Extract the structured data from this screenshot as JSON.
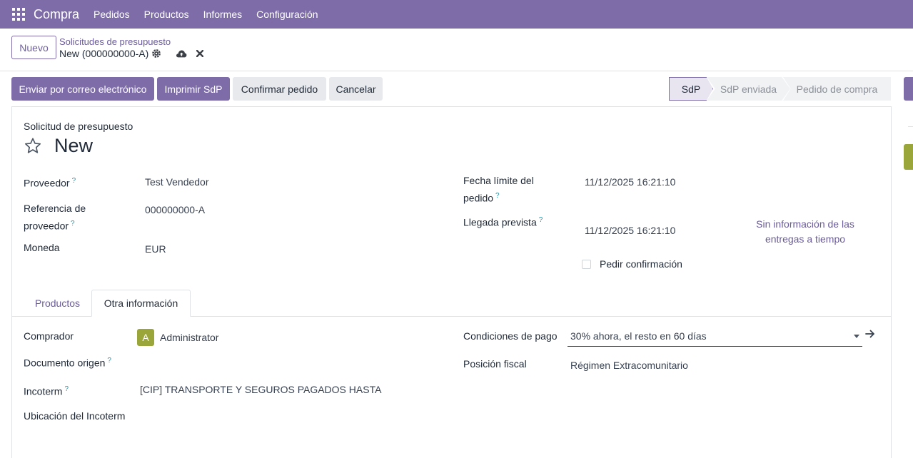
{
  "nav": {
    "app_name": "Compra",
    "menu": [
      "Pedidos",
      "Productos",
      "Informes",
      "Configuración"
    ]
  },
  "control_panel": {
    "new_button": "Nuevo",
    "breadcrumb_parent": "Solicitudes de presupuesto",
    "breadcrumb_current": "New (000000000-A)"
  },
  "actions": {
    "send_email": "Enviar por correo electrónico",
    "print_rfq": "Imprimir SdP",
    "confirm_order": "Confirmar pedido",
    "cancel": "Cancelar"
  },
  "statusbar": [
    "SdP",
    "SdP enviada",
    "Pedido de compra"
  ],
  "form": {
    "subtitle": "Solicitud de presupuesto",
    "title": "New",
    "left": {
      "vendor_label": "Proveedor",
      "vendor_value": "Test Vendedor",
      "vendor_ref_label_1": "Referencia de",
      "vendor_ref_label_2": "proveedor",
      "vendor_ref_value": "000000000-A",
      "currency_label": "Moneda",
      "currency_value": "EUR"
    },
    "right": {
      "deadline_label_1": "Fecha límite del",
      "deadline_label_2": "pedido",
      "deadline_value": "11/12/2025 16:21:10",
      "arrival_label": "Llegada prevista",
      "arrival_value": "11/12/2025 16:21:10",
      "on_time_link_1": "Sin información de las",
      "on_time_link_2": "entregas a tiempo",
      "ask_confirmation": "Pedir confirmación"
    },
    "help_mark": "?"
  },
  "tabs": [
    "Productos",
    "Otra información"
  ],
  "other_info": {
    "buyer_label": "Comprador",
    "buyer_avatar": "A",
    "buyer_value": "Administrator",
    "source_doc_label": "Documento origen",
    "incoterm_label": "Incoterm",
    "incoterm_value": "[CIP] TRANSPORTE Y SEGUROS PAGADOS HASTA",
    "incoterm_location_label": "Ubicación del Incoterm",
    "payment_terms_label": "Condiciones de pago",
    "payment_terms_value": "30% ahora, el resto en 60 días",
    "fiscal_position_label": "Posición fiscal",
    "fiscal_position_value": "Régimen Extracomunitario"
  }
}
